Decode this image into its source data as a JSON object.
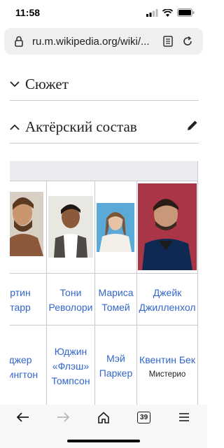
{
  "status": {
    "time": "11:58"
  },
  "browser": {
    "url": "ru.m.wikipedia.org/wiki/..."
  },
  "sections": [
    {
      "title": "Сюжет",
      "expanded": false
    },
    {
      "title": "Актёрский состав",
      "expanded": true
    }
  ],
  "cast": {
    "row1": [
      {
        "name": "ртин",
        "name2": "тарр"
      },
      {
        "name": "Тони",
        "name2": "Револори"
      },
      {
        "name": "Мариса",
        "name2": "Томей"
      },
      {
        "name": "Джейк",
        "name2": "Джилленхол"
      }
    ],
    "row2": [
      {
        "name": "джер",
        "name2": "рингтон"
      },
      {
        "name": "Юджин",
        "name2": "«Флэш»",
        "name3": "Томпсон"
      },
      {
        "name": "Мэй",
        "name2": "Паркер"
      },
      {
        "name": "Квентин Бек",
        "sub": "Мистерио"
      }
    ]
  },
  "toolbar": {
    "tab_count": "39"
  }
}
